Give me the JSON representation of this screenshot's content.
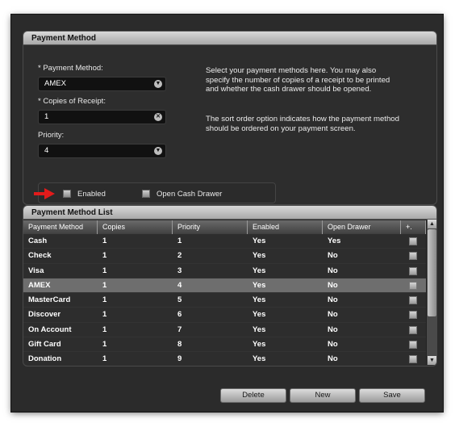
{
  "payment_method_panel": {
    "title": "Payment Method",
    "payment_method_label": "* Payment Method:",
    "payment_method_value": "AMEX",
    "copies_label": "* Copies of Receipt:",
    "copies_value": "1",
    "priority_label": "Priority:",
    "priority_value": "4",
    "help_paragraph_1": "Select your payment methods here.  You may also specify the number of copies of a receipt to be printed and whether the cash drawer should be opened.",
    "help_paragraph_2": "The sort order option indicates how the payment method should be ordered on your payment screen.",
    "enabled_label": "Enabled",
    "open_cash_drawer_label": "Open Cash Drawer"
  },
  "list_panel": {
    "title": "Payment Method List",
    "columns": [
      "Payment Method",
      "Copies",
      "Priority",
      "Enabled",
      "Open Drawer",
      "+."
    ],
    "rows": [
      {
        "name": "Cash",
        "copies": "1",
        "priority": "1",
        "enabled": "Yes",
        "open_drawer": "Yes"
      },
      {
        "name": "Check",
        "copies": "1",
        "priority": "2",
        "enabled": "Yes",
        "open_drawer": "No"
      },
      {
        "name": "Visa",
        "copies": "1",
        "priority": "3",
        "enabled": "Yes",
        "open_drawer": "No"
      },
      {
        "name": "AMEX",
        "copies": "1",
        "priority": "4",
        "enabled": "Yes",
        "open_drawer": "No"
      },
      {
        "name": "MasterCard",
        "copies": "1",
        "priority": "5",
        "enabled": "Yes",
        "open_drawer": "No"
      },
      {
        "name": "Discover",
        "copies": "1",
        "priority": "6",
        "enabled": "Yes",
        "open_drawer": "No"
      },
      {
        "name": "On Account",
        "copies": "1",
        "priority": "7",
        "enabled": "Yes",
        "open_drawer": "No"
      },
      {
        "name": "Gift Card",
        "copies": "1",
        "priority": "8",
        "enabled": "Yes",
        "open_drawer": "No"
      },
      {
        "name": "Donation",
        "copies": "1",
        "priority": "9",
        "enabled": "Yes",
        "open_drawer": "No"
      }
    ],
    "selected_row": "AMEX"
  },
  "footer": {
    "delete_label": "Delete",
    "new_label": "New",
    "save_label": "Save"
  },
  "colors": {
    "background": "#2b2b2b",
    "selected_row": "#6e6e6e",
    "arrow": "#e31b1b"
  },
  "icons": {
    "dropdown": "chevron-down-icon",
    "clear": "clear-x-icon",
    "annotation": "red-arrow-icon"
  }
}
